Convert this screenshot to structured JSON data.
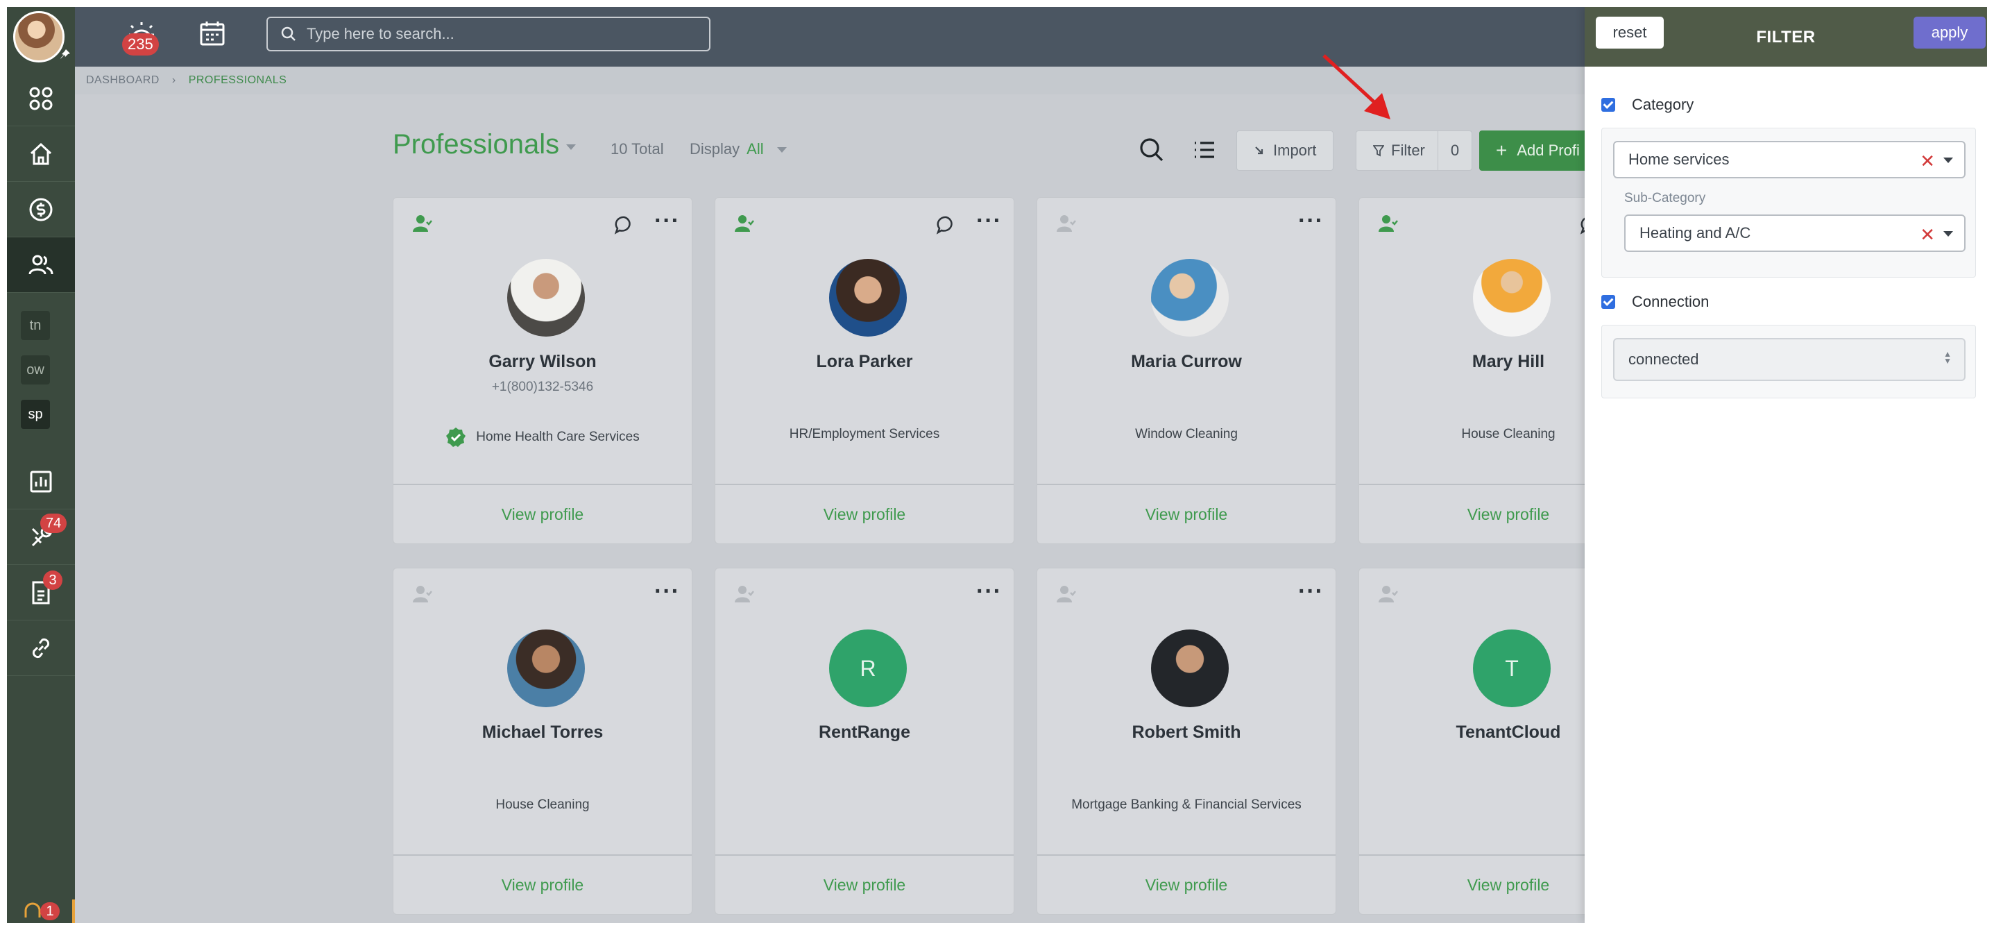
{
  "topbar": {
    "notifications_count": "235",
    "search_placeholder": "Type here to search..."
  },
  "sidebar": {
    "text_items": [
      "tn",
      "ow",
      "sp"
    ],
    "tools_badge": "74",
    "docs_badge": "3",
    "bottom_badge": "1"
  },
  "breadcrumb": {
    "root": "DASHBOARD",
    "current": "PROFESSIONALS"
  },
  "header": {
    "title": "Professionals",
    "total": "10 Total",
    "display_label": "Display",
    "display_value": "All",
    "import_label": "Import",
    "filter_label": "Filter",
    "filter_count": "0",
    "add_label": "Add Profi"
  },
  "cards": [
    {
      "name": "Garry Wilson",
      "phone": "+1(800)132-5346",
      "service": "Home Health Care Services",
      "connected": true,
      "chat": true,
      "verified": true,
      "avatar_letter": "",
      "view": "View profile"
    },
    {
      "name": "Lora Parker",
      "phone": "",
      "service": "HR/Employment Services",
      "connected": true,
      "chat": true,
      "verified": false,
      "avatar_letter": "",
      "view": "View profile"
    },
    {
      "name": "Maria Currow",
      "phone": "",
      "service": "Window Cleaning",
      "connected": false,
      "chat": false,
      "verified": false,
      "avatar_letter": "",
      "view": "View profile"
    },
    {
      "name": "Mary Hill",
      "phone": "",
      "service": "House Cleaning",
      "connected": true,
      "chat": true,
      "verified": false,
      "avatar_letter": "",
      "view": "View profile"
    },
    {
      "name": "Michael Torres",
      "phone": "",
      "service": "House Cleaning",
      "connected": false,
      "chat": false,
      "verified": false,
      "avatar_letter": "",
      "view": "View profile"
    },
    {
      "name": "RentRange",
      "phone": "",
      "service": "",
      "connected": false,
      "chat": false,
      "verified": false,
      "avatar_letter": "R",
      "view": "View profile"
    },
    {
      "name": "Robert Smith",
      "phone": "",
      "service": "Mortgage Banking & Financial Services",
      "connected": false,
      "chat": false,
      "verified": false,
      "avatar_letter": "",
      "view": "View profile"
    },
    {
      "name": "TenantCloud",
      "phone": "",
      "service": "",
      "connected": false,
      "chat": false,
      "verified": false,
      "avatar_letter": "T",
      "view": "View profile"
    }
  ],
  "filter_panel": {
    "reset_label": "reset",
    "title": "FILTER",
    "apply_label": "apply",
    "category_label": "Category",
    "category_value": "Home services",
    "subcategory_label": "Sub-Category",
    "subcategory_value": "Heating and A/C",
    "connection_label": "Connection",
    "connection_value": "connected"
  },
  "colors": {
    "accent_green": "#3f9a4e",
    "apply_purple": "#6f6ecd",
    "badge_red": "#d24343",
    "arrow_red": "#e02020"
  }
}
